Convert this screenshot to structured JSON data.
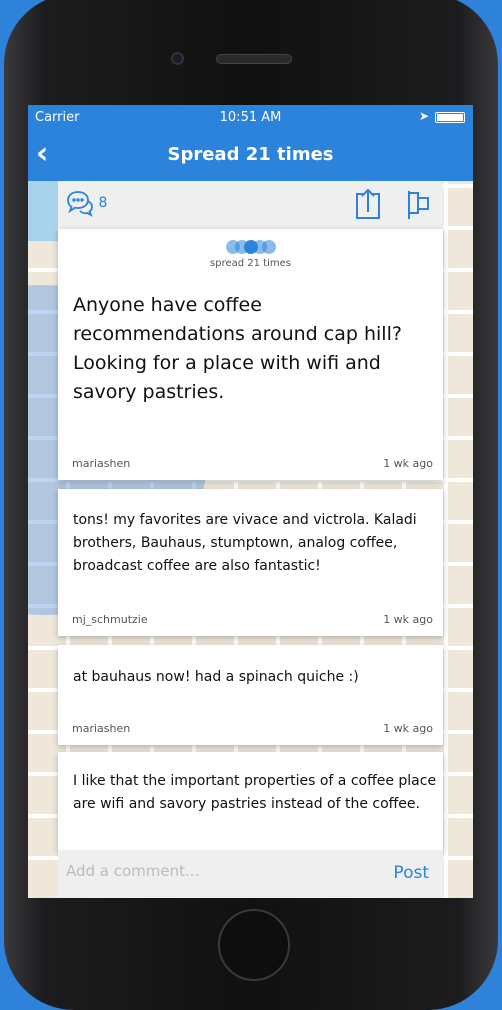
{
  "status": {
    "carrier": "Carrier",
    "time": "10:51 AM"
  },
  "nav": {
    "back_icon": "chevron-left",
    "title": "Spread 21 times"
  },
  "toolbar": {
    "comment_count": "8",
    "icons": [
      "comment-bubbles",
      "share",
      "flag"
    ]
  },
  "post": {
    "spread_label": "spread 21 times",
    "text": "Anyone have coffee recommendations around cap hill? Looking for a place with wifi and savory pastries.",
    "user": "mariashen",
    "time": "1 wk ago"
  },
  "comments": [
    {
      "text": "tons! my favorites are vivace and victrola. Kaladi brothers, Bauhaus, stumptown, analog coffee, broadcast coffee are also fantastic!",
      "user": "mj_schmutzie",
      "time": "1 wk ago"
    },
    {
      "text": "at bauhaus now! had a spinach quiche :)",
      "user": "mariashen",
      "time": "1 wk ago"
    },
    {
      "text": "I like that the important properties of a coffee place are wifi and savory pastries instead of the coffee."
    }
  ],
  "input": {
    "placeholder": "Add a comment...",
    "post_label": "Post"
  },
  "colors": {
    "accent": "#2b83dc"
  }
}
